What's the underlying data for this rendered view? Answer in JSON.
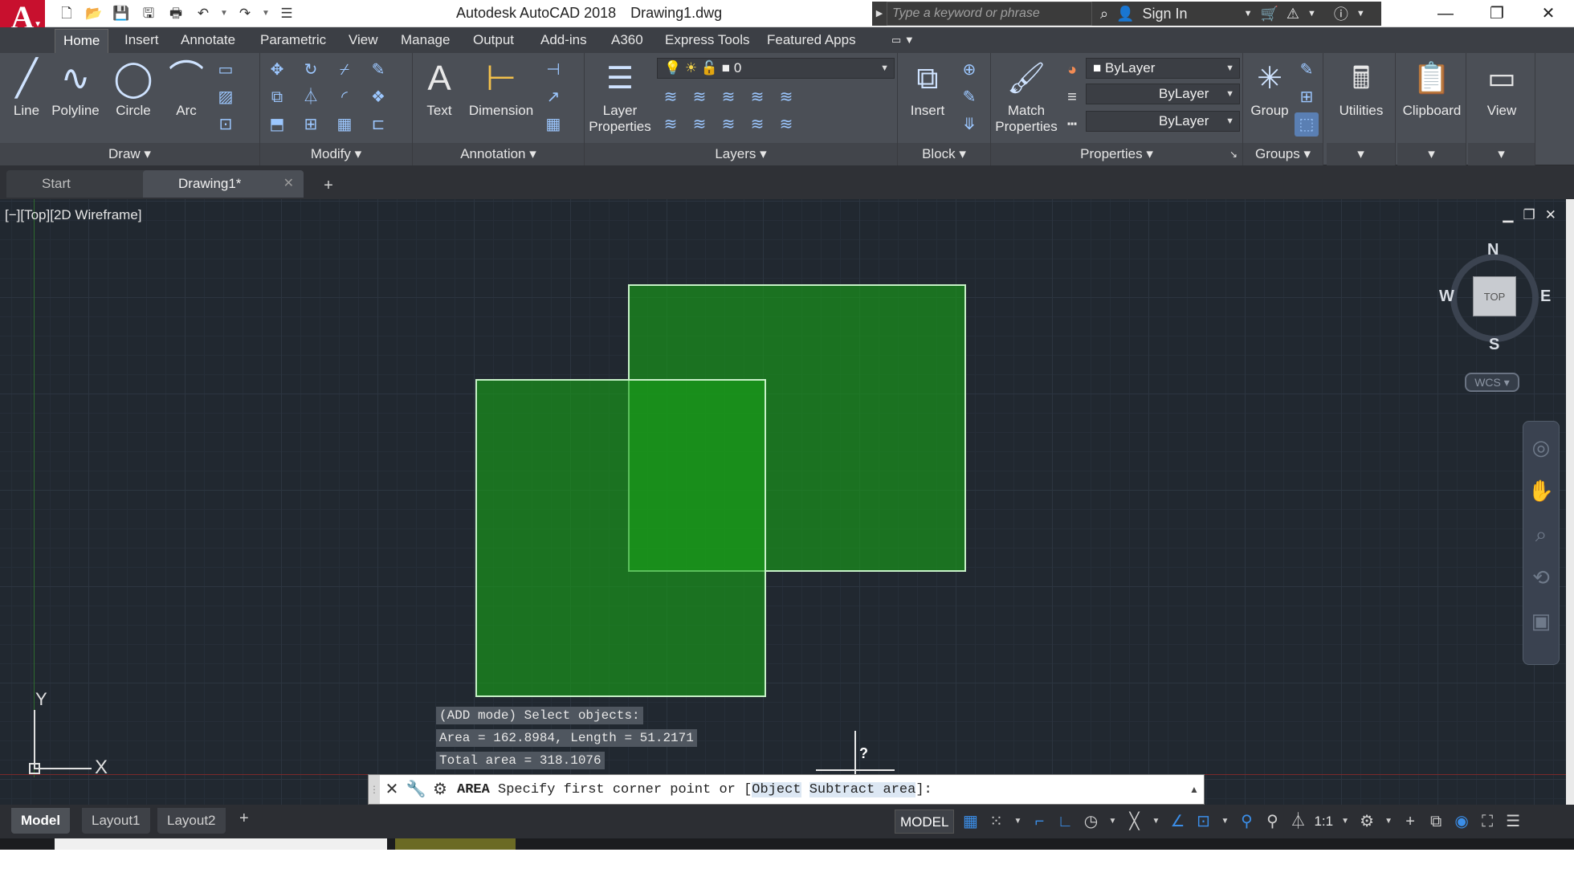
{
  "titlebar": {
    "app": "Autodesk AutoCAD 2018",
    "file": "Drawing1.dwg",
    "search_placeholder": "Type a keyword or phrase",
    "sign_in": "Sign In"
  },
  "ribbon": {
    "tabs": [
      "Home",
      "Insert",
      "Annotate",
      "Parametric",
      "View",
      "Manage",
      "Output",
      "Add-ins",
      "A360",
      "Express Tools",
      "Featured Apps"
    ],
    "draw": {
      "title": "Draw",
      "line": "Line",
      "polyline": "Polyline",
      "circle": "Circle",
      "arc": "Arc"
    },
    "modify": {
      "title": "Modify"
    },
    "annotation": {
      "title": "Annotation",
      "text": "Text",
      "dimension": "Dimension"
    },
    "layers": {
      "title": "Layers",
      "layer_properties_1": "Layer",
      "layer_properties_2": "Properties",
      "current_layer": "0"
    },
    "block": {
      "title": "Block",
      "insert": "Insert"
    },
    "properties": {
      "title": "Properties",
      "match_1": "Match",
      "match_2": "Properties",
      "color": "ByLayer",
      "linetype": "ByLayer",
      "lineweight": "ByLayer"
    },
    "groups": {
      "title": "Groups",
      "group": "Group"
    },
    "utilities": "Utilities",
    "clipboard": "Clipboard",
    "view": "View"
  },
  "filetabs": {
    "start": "Start",
    "drawing": "Drawing1*"
  },
  "viewport": {
    "label": "[−][Top][2D Wireframe]",
    "tooltip_1": "(ADD mode) Select objects:",
    "tooltip_2": "Area = 162.8984, Length = 51.2171",
    "tooltip_3": "Total area = 318.1076",
    "cursor_badge": "?",
    "ucs_y": "Y",
    "ucs_x": "X"
  },
  "viewcube": {
    "face": "TOP",
    "n": "N",
    "s": "S",
    "e": "E",
    "w": "W",
    "wcs": "WCS"
  },
  "command": {
    "keyword": "AREA",
    "prompt": "Specify first corner point or [",
    "opt_object": "Object",
    "opt_subtract": "Subtract area",
    "end": "]:"
  },
  "layout_tabs": [
    "Model",
    "Layout1",
    "Layout2"
  ],
  "status": {
    "model": "MODEL",
    "scale": "1:1"
  },
  "colors": {
    "shape_fill": "#18a018",
    "shape_border": "#c7f1c7",
    "viewport_bg": "#212830",
    "logo": "#c8102e"
  }
}
